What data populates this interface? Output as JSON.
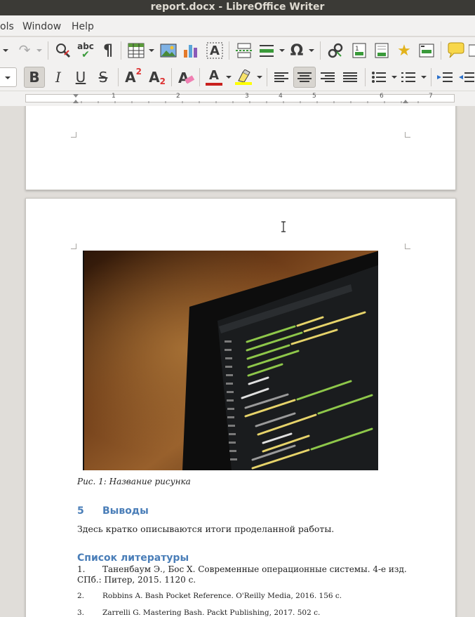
{
  "window": {
    "title": "report.docx - LibreOffice Writer"
  },
  "menu": {
    "items": [
      "ols",
      "Window",
      "Help"
    ]
  },
  "toolbar": {
    "spell_check_label": "abc",
    "formatting_marks_label": "¶",
    "bold_label": "B",
    "italic_label": "I",
    "underline_label": "U",
    "strike_label": "S",
    "superscript_label": "A",
    "superscript_exp": "2",
    "subscript_label": "A",
    "subscript_exp": "2",
    "font_color_label": "A",
    "special_char_label": "Ω",
    "font_color": "#c9211e",
    "highlight_color": "#ffff00",
    "text_box_label": "A"
  },
  "ruler": {
    "numbers": [
      "1",
      "2",
      "3",
      "4",
      "5",
      "6",
      "7"
    ]
  },
  "document": {
    "caption": "Рис. 1: Название рисунка",
    "section": {
      "number": "5",
      "title": "Выводы"
    },
    "conclusion_text": "Здесь кратко описываются итоги проделанной работы.",
    "references_title": "Список литературы",
    "references": [
      {
        "num": "1.",
        "text": "Таненбаум Э., Бос Х. Современные операционные системы. 4-е изд.",
        "cont": "СПб.: Питер, 2015. 1120 с."
      },
      {
        "num": "2.",
        "text": "Robbins A. Bash Pocket Reference. O'Reilly Media, 2016. 156 c.",
        "cont": ""
      },
      {
        "num": "3.",
        "text": "Zarrelli G. Mastering Bash. Packt Publishing, 2017. 502 c.",
        "cont": ""
      }
    ]
  },
  "colors": {
    "heading": "#4a7eb8",
    "title_bar": "#3b3a36",
    "ui_bg": "#f2f1f0"
  }
}
